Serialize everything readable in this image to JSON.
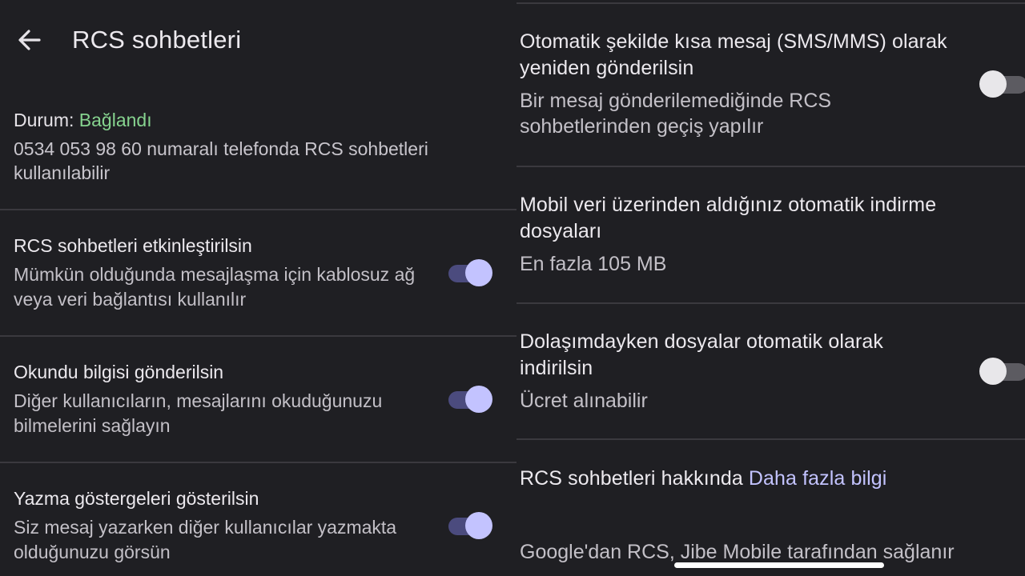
{
  "header": {
    "title": "RCS sohbetleri",
    "back_icon": "arrow-left-icon"
  },
  "status": {
    "label": "Durum:",
    "value": "Bağlandı",
    "value_color": "#86d38f",
    "description": "0534 053 98 60 numaralı telefonda RCS sohbetleri kullanılabilir"
  },
  "left_settings": [
    {
      "title": "RCS sohbetleri etkinleştirilsin",
      "description": "Mümkün olduğunda mesajlaşma için kablosuz ağ veya veri bağlantısı kullanılır",
      "enabled": true
    },
    {
      "title": "Okundu bilgisi gönderilsin",
      "description": "Diğer kullanıcıların, mesajlarını okuduğunuzu bilmelerini sağlayın",
      "enabled": true
    },
    {
      "title": "Yazma göstergeleri gösterilsin",
      "description": "Siz mesaj yazarken diğer kullanıcılar yazmakta olduğunuzu görsün",
      "enabled": true
    }
  ],
  "right_settings": [
    {
      "title": "Otomatik şekilde kısa mesaj (SMS/MMS) olarak yeniden gönderilsin",
      "description": "Bir mesaj gönderilemediğinde RCS sohbetlerinden geçiş yapılır",
      "enabled": false
    },
    {
      "title": "Mobil veri üzerinden aldığınız otomatik indirme dosyaları",
      "description": "En fazla 105 MB"
    },
    {
      "title": "Dolaşımdayken dosyalar otomatik olarak indirilsin",
      "description": "Ücret alınabilir",
      "enabled": false
    }
  ],
  "about": {
    "text": "RCS sohbetleri hakkında",
    "link": "Daha fazla bilgi"
  },
  "footer": {
    "text": "Google'dan RCS, Jibe Mobile tarafından sağlanır"
  },
  "colors": {
    "background": "#1f1f23",
    "accent": "#c3c3ff",
    "toggle_on_track": "#4b4b7e",
    "status_connected": "#86d38f"
  }
}
